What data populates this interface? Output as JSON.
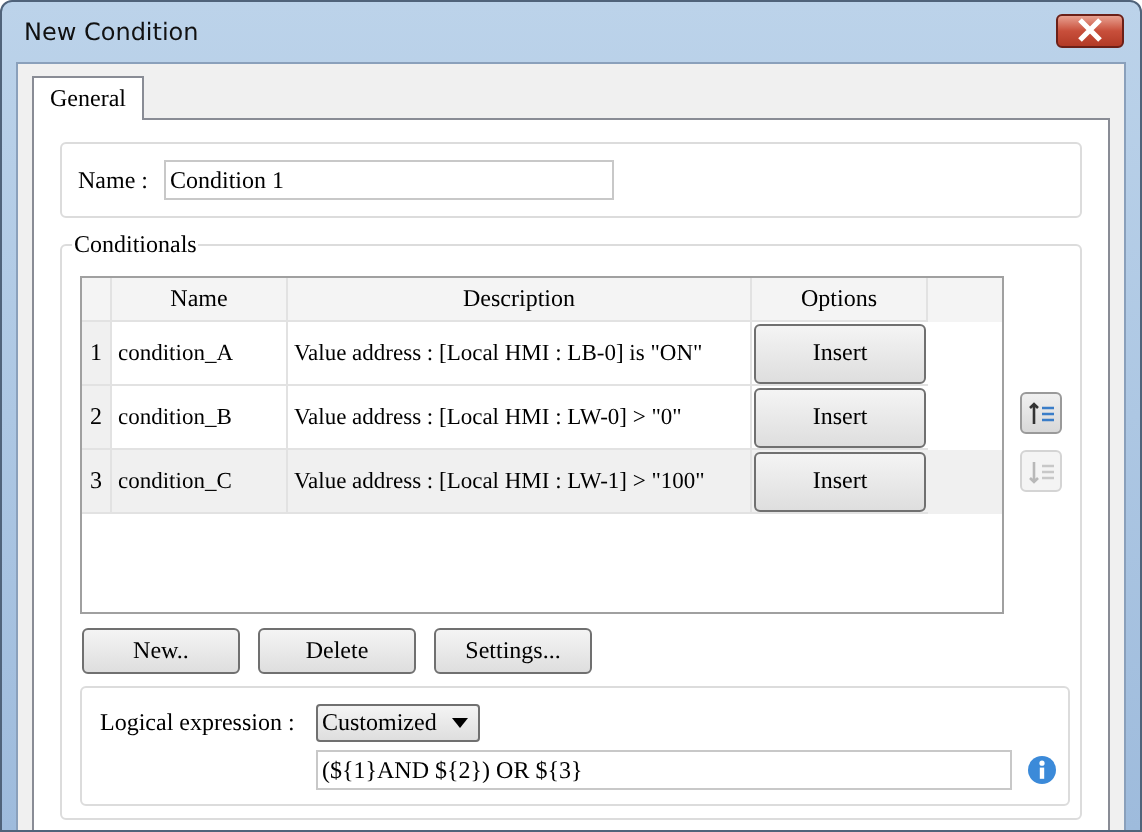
{
  "window": {
    "title": "New Condition"
  },
  "tabs": [
    {
      "label": "General",
      "selected": true
    }
  ],
  "name_field": {
    "label": "Name :",
    "value": "Condition 1"
  },
  "conditionals": {
    "title": "Conditionals",
    "columns": [
      "Name",
      "Description",
      "Options"
    ],
    "rows": [
      {
        "index": "1",
        "name": "condition_A",
        "description": "Value address : [Local HMI : LB-0] is \"ON\"",
        "button": "Insert",
        "selected": false
      },
      {
        "index": "2",
        "name": "condition_B",
        "description": "Value address : [Local HMI : LW-0] > \"0\"",
        "button": "Insert",
        "selected": false
      },
      {
        "index": "3",
        "name": "condition_C",
        "description": "Value address : [Local HMI : LW-1] > \"100\"",
        "button": "Insert",
        "selected": true
      }
    ],
    "side_buttons": [
      {
        "kind": "up",
        "disabled": false
      },
      {
        "kind": "down",
        "disabled": true
      }
    ],
    "buttons": [
      "New..",
      "Delete",
      "Settings..."
    ],
    "logical": {
      "label": "Logical expression :",
      "mode": "Customized",
      "expression": "(${1}AND ${2}) OR ${3}"
    }
  }
}
